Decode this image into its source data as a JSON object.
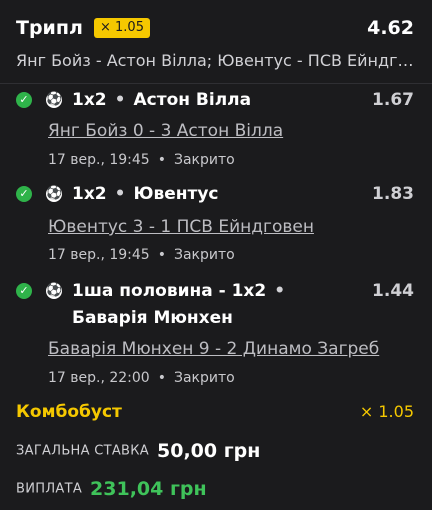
{
  "header": {
    "title": "Трипл",
    "boost_badge": "× 1.05",
    "total_odds": "4.62",
    "summary": "Янг Бойз - Астон Вілла; Ювентус - ПСВ Ейндговен"
  },
  "selections": [
    {
      "market": "1x2",
      "pick": "Астон Вілла",
      "odds": "1.67",
      "event": "Янг Бойз 0 - 3 Астон Вілла",
      "time": "17 вер., 19:45",
      "status": "Закрито"
    },
    {
      "market": "1x2",
      "pick": "Ювентус",
      "odds": "1.83",
      "event": "Ювентус 3 - 1 ПСВ Ейндговен",
      "time": "17 вер., 19:45",
      "status": "Закрито"
    },
    {
      "market": "1ша половина - 1x2",
      "pick": "Баварія Мюнхен",
      "odds": "1.44",
      "event": "Баварія Мюнхен 9 - 2 Динамо Загреб",
      "time": "17 вер., 22:00",
      "status": "Закрито"
    }
  ],
  "separator": "•",
  "icons": {
    "won": "check-circle-icon",
    "sport": "soccer-ball-icon"
  },
  "combo": {
    "label": "Комбобуст",
    "value": "× 1.05"
  },
  "stake": {
    "label": "ЗАГАЛЬНА СТАВКА",
    "value": "50,00 грн"
  },
  "payout": {
    "label": "ВИПЛАТА",
    "value": "231,04 грн"
  },
  "colors": {
    "accent": "#f5c800",
    "win": "#2fb34a",
    "payout": "#3fc35a",
    "background": "#1b1b1d"
  }
}
